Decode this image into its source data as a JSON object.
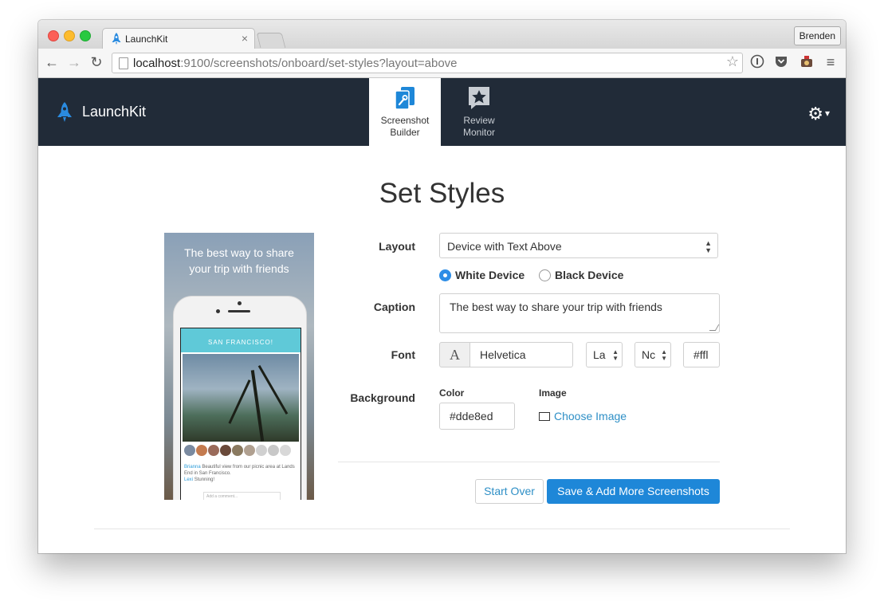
{
  "browser": {
    "tab_title": "LaunchKit",
    "tab_close": "×",
    "user_button": "Brenden",
    "url_host": "localhost",
    "url_rest": ":9100/screenshots/onboard/set-styles?layout=above",
    "back": "←",
    "forward": "→",
    "reload": "↻",
    "bookmark": "☆",
    "menu": "≡"
  },
  "app": {
    "brand": "LaunchKit",
    "tabs": [
      {
        "line1": "Screenshot",
        "line2": "Builder"
      },
      {
        "line1": "Review",
        "line2": "Monitor"
      }
    ],
    "settings_icon": "⚙",
    "settings_caret": "▾"
  },
  "page": {
    "title": "Set Styles"
  },
  "preview": {
    "caption_line1": "The best way to share",
    "caption_line2": "your trip with friends",
    "city": "SAN FRANCISCO!",
    "comment_user": "Brianna",
    "comment_text": "Beautiful view from our picnic area at Lands End in San Francisco.",
    "reply_user": "Lexi",
    "reply_text": "Stunning!",
    "add_comment": "Add a comment..."
  },
  "form": {
    "layout_label": "Layout",
    "layout_value": "Device with Text Above",
    "radio_white": "White Device",
    "radio_black": "Black Device",
    "caption_label": "Caption",
    "caption_value": "The best way to share your trip with friends",
    "font_label": "Font",
    "font_icon": "A",
    "font_value": "Helvetica",
    "font_size_value": "La",
    "font_weight_value": "Nc",
    "font_color_value": "#ffl",
    "background_label": "Background",
    "color_label": "Color",
    "color_value": "#dde8ed",
    "image_label": "Image",
    "choose_image": "Choose Image",
    "start_over": "Start Over",
    "save": "Save & Add More Screenshots"
  },
  "colors": {
    "nav_bg": "#212b38",
    "primary": "#1e87d8",
    "link": "#2e8fc6"
  }
}
